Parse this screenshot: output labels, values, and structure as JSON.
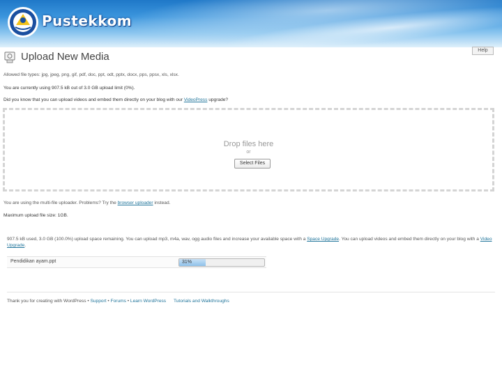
{
  "header": {
    "brand": "Pustekkom"
  },
  "page": {
    "title": "Upload New Media",
    "help_label": "Help"
  },
  "info": {
    "allowed_types": "Allowed file types: jpg, jpeg, png, gif, pdf, doc, ppt, odt, pptx, docx, pps, ppsx, xls, xlsx.",
    "usage": "You are currently using 907.5 kB out of 3.0 GB upload limit (0%).",
    "videopress_before": "Did you know that you can upload videos and embed them directly on your blog with our ",
    "videopress_link": "VideoPress",
    "videopress_after": " upgrade?"
  },
  "dropzone": {
    "drop_text": "Drop files here",
    "or_text": "or",
    "select_button": "Select Files"
  },
  "uploader_note": {
    "before": "You are using the multi-file uploader. Problems? Try the ",
    "link": "browser uploader",
    "after": " instead."
  },
  "max_size": "Maximum upload file size: 1GB.",
  "remaining": {
    "part1": "907.5 kB used, 3.0 GB (100.0%) upload space remaining. You can upload mp3, m4a, wav, ogg audio files and increase your available space with a ",
    "link1": "Space Upgrade",
    "part2": ". You can upload videos and embed them directly on your blog with a ",
    "link2_line1": "Video",
    "link2_line2": "Upgrade",
    "part3": "."
  },
  "upload_item": {
    "filename": "Pendidikan ayam.ppt",
    "progress_label": "31%",
    "progress": 0.31
  },
  "footer": {
    "thanks": "Thank you for creating with WordPress",
    "links": [
      "Support",
      "Forums",
      "Learn WordPress",
      "Tutorials and Walkthroughs"
    ]
  },
  "colors": {
    "link": "#21759b",
    "banner_top": "#1f78c8",
    "progress_fill": "#8fc1ea"
  }
}
